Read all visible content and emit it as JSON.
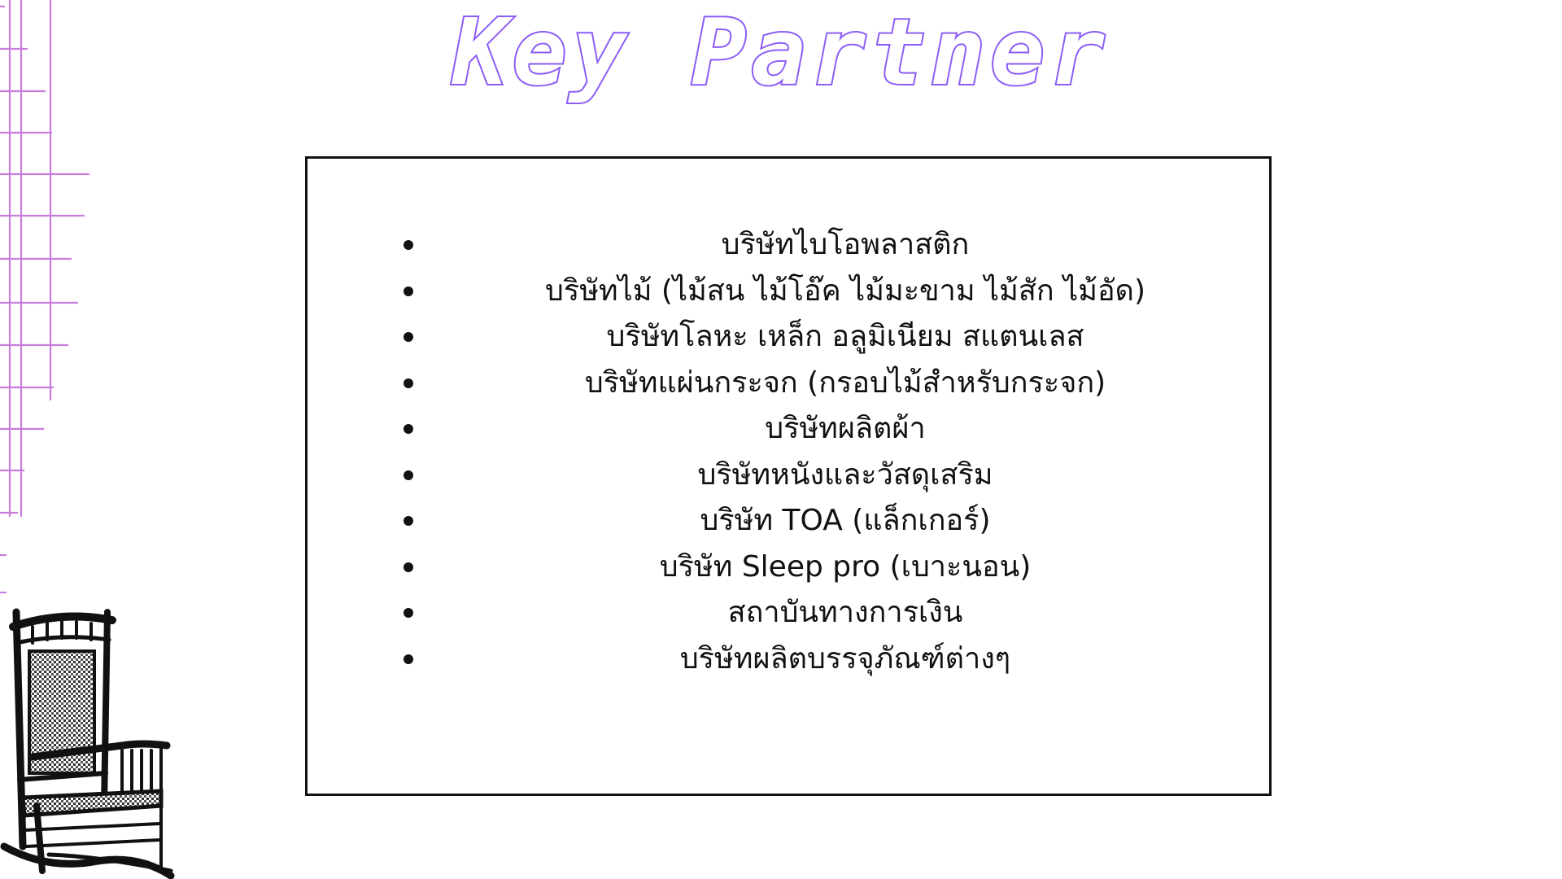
{
  "slide": {
    "title": "Key Partner",
    "accent_color": "#8b5cf6",
    "grid_color": "#c77ddb",
    "partners": [
      "บริษัทไบโอพลาสติก",
      "บริษัทไม้ (ไม้สน ไม้โอ๊ค ไม้มะขาม ไม้สัก ไม้อัด)",
      "บริษัทโลหะ เหล็ก อลูมิเนียม สแตนเลส",
      "บริษัทแผ่นกระจก (กรอบไม้สำหรับกระจก)",
      "บริษัทผลิตผ้า",
      "บริษัทหนังและวัสดุเสริม",
      "บริษัท TOA (แล็กเกอร์)",
      "บริษัท Sleep pro (เบาะนอน)",
      "สถาบันทางการเงิน",
      "บริษัทผลิตบรรจุภัณฑ์ต่างๆ"
    ]
  }
}
